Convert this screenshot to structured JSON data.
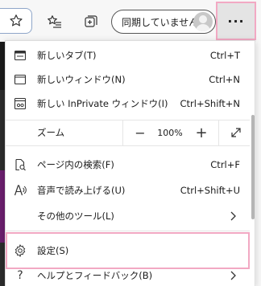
{
  "toolbar": {
    "favorites_icon": "star-outline-icon",
    "favorites_list_icon": "favorites-list-icon",
    "collections_icon": "collections-icon",
    "profile_label": "同期していません",
    "more_label": "···"
  },
  "menu": {
    "new_tab": {
      "label": "新しいタブ(T)",
      "shortcut": "Ctrl+T"
    },
    "new_window": {
      "label": "新しいウィンドウ(N)",
      "shortcut": "Ctrl+N"
    },
    "new_private": {
      "label": "新しい InPrivate ウィンドウ(I)",
      "shortcut": "Ctrl+Shift+N"
    },
    "zoom": {
      "label": "ズーム",
      "minus": "−",
      "value": "100%",
      "plus": "+"
    },
    "find": {
      "label": "ページ内の検索(F)",
      "shortcut": "Ctrl+F"
    },
    "read_aloud": {
      "label": "音声で読み上げる(U)",
      "shortcut": "Ctrl+Shift+U"
    },
    "more_tools": {
      "label": "その他のツール(L)"
    },
    "settings": {
      "label": "設定(S)"
    },
    "help": {
      "label": "ヘルプとフィードバック(B)"
    }
  },
  "colors": {
    "highlight": "#f2a9c3",
    "toolbar_bg": "#f7f7f7"
  }
}
